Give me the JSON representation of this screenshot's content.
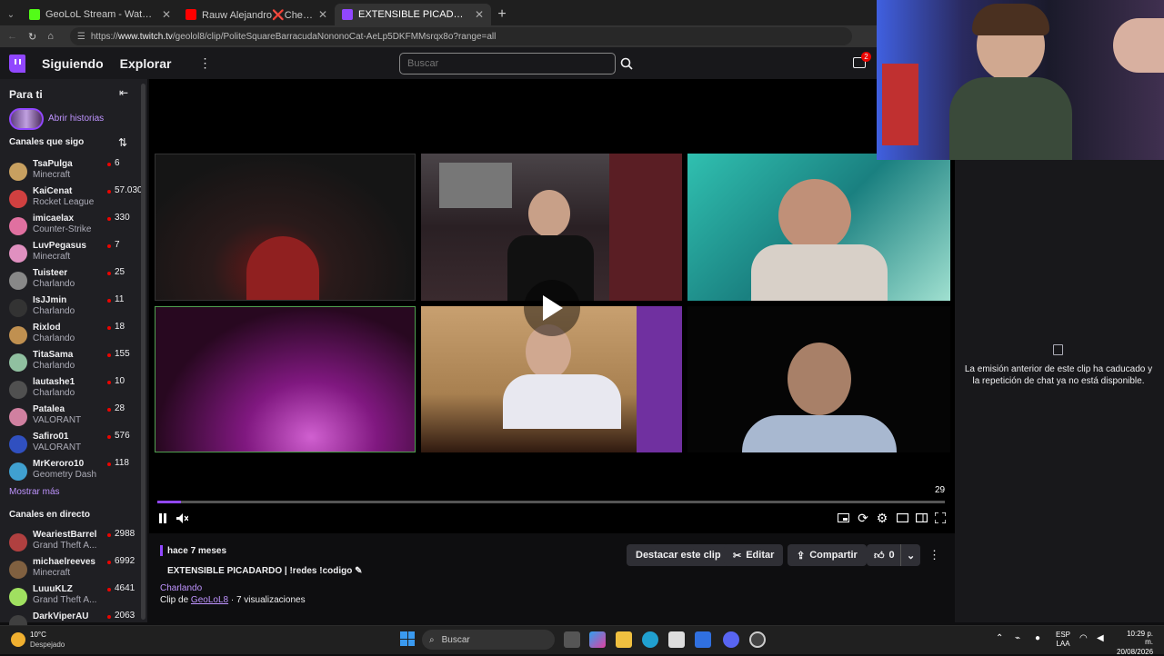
{
  "browser": {
    "tabs": [
      {
        "label": "GeoLoL Stream - Watch Live on K",
        "color": "#53fc18",
        "active": false
      },
      {
        "label": "Rauw Alejandro❌Chencho Corle",
        "color": "#ff0000",
        "active": false
      },
      {
        "label": "EXTENSIBLE PICADARDO | !redes |",
        "color": "#9147ff",
        "active": true
      }
    ],
    "url_prefix": "https://",
    "url_host": "www.twitch.tv",
    "url_path": "/geolol8/clip/PoliteSquareBarracudaNononoCat-AeLp5DKFMMsrqx8o?range=all"
  },
  "topnav": {
    "following": "Siguiendo",
    "browse": "Explorar",
    "search_placeholder": "Buscar",
    "notification_count": "2"
  },
  "sidebar": {
    "for_you": "Para ti",
    "stories": "Abrir historias",
    "followed_header": "Canales que sigo",
    "followed": [
      {
        "name": "TsaPulga",
        "game": "Minecraft",
        "viewers": "6",
        "color": "#c8a060"
      },
      {
        "name": "KaiCenat",
        "game": "Rocket League",
        "viewers": "57.030",
        "color": "#d04040"
      },
      {
        "name": "imicaelax",
        "game": "Counter-Strike",
        "viewers": "330",
        "color": "#e070a0"
      },
      {
        "name": "LuvPegasus",
        "game": "Minecraft",
        "viewers": "7",
        "color": "#e090c0"
      },
      {
        "name": "Tuisteer",
        "game": "Charlando",
        "viewers": "25",
        "color": "#888888"
      },
      {
        "name": "IsJJmin",
        "game": "Charlando",
        "viewers": "11",
        "color": "#333333"
      },
      {
        "name": "Rixlod",
        "game": "Charlando",
        "viewers": "18",
        "color": "#c09050"
      },
      {
        "name": "TitaSama",
        "game": "Charlando",
        "viewers": "155",
        "color": "#90c0a0"
      },
      {
        "name": "lautashe1",
        "game": "Charlando",
        "viewers": "10",
        "color": "#505050"
      },
      {
        "name": "Patalea",
        "game": "VALORANT",
        "viewers": "28",
        "color": "#d080a0"
      },
      {
        "name": "Safiro01",
        "game": "VALORANT",
        "viewers": "576",
        "color": "#3050c0"
      },
      {
        "name": "MrKeroro10",
        "game": "Geometry Dash",
        "viewers": "118",
        "color": "#40a0d0"
      }
    ],
    "show_more": "Mostrar más",
    "live_header": "Canales en directo",
    "live": [
      {
        "name": "WeariestBarrel",
        "game": "Grand Theft A...",
        "viewers": "2988",
        "color": "#b04040"
      },
      {
        "name": "michaelreeves",
        "game": "Minecraft",
        "viewers": "6992",
        "color": "#806040"
      },
      {
        "name": "LuuuKLZ",
        "game": "Grand Theft A...",
        "viewers": "4641",
        "color": "#a0e060"
      },
      {
        "name": "DarkViperAU",
        "game": "",
        "viewers": "2063",
        "color": "#404040"
      }
    ]
  },
  "player": {
    "time": "29",
    "progress": 0.03
  },
  "clip": {
    "age": "hace 7 meses",
    "title": "EXTENSIBLE PICADARDO | !redes !codigo",
    "category": "Charlando",
    "clip_by_prefix": "Clip de",
    "channel": "GeoLoL8",
    "views": "· 7 visualizaciones",
    "highlight": "Destacar este clip",
    "edit": "Editar",
    "share": "Compartir",
    "likes": "0"
  },
  "chat": {
    "message": "La emisión anterior de este clip ha caducado y la repetición de chat ya no está disponible."
  },
  "taskbar": {
    "temp": "10°C",
    "weather": "Despejado",
    "search": "Buscar",
    "lang1": "ESP",
    "lang2": "LAA",
    "time": "10:29 p. m.",
    "date": "20/08/2026"
  }
}
